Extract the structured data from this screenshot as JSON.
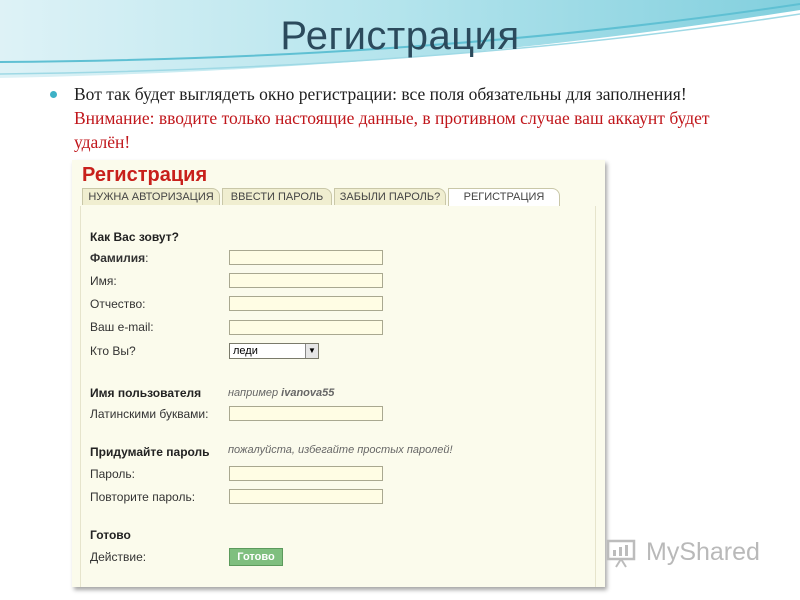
{
  "slide": {
    "title": "Регистрация",
    "bullet_text": "Вот так будет выглядеть окно регистрации: все поля обязательны для заполнения! ",
    "bullet_warning": "Внимание: вводите только настоящие данные, в противном случае ваш аккаунт будет удалён!"
  },
  "window": {
    "header": "Регистрация",
    "tabs": [
      "НУЖНА АВТОРИЗАЦИЯ",
      "ВВЕСТИ ПАРОЛЬ",
      "ЗАБЫЛИ ПАРОЛЬ?",
      "РЕГИСТРАЦИЯ"
    ],
    "active_tab": "РЕГИСТРАЦИЯ",
    "section_name": "Как Вас зовут?",
    "surname_label": "Фамилия",
    "surname_colon": ":",
    "name_label": "Имя:",
    "patronymic_label": "Отчество:",
    "email_label": "Ваш e-mail:",
    "who_label": "Кто Вы?",
    "who_value": "леди",
    "section_username": "Имя пользователя",
    "username_hint_prefix": "например ",
    "username_hint_example": "ivanova55",
    "latin_label": "Латинскими буквами:",
    "section_password": "Придумайте пароль",
    "password_hint": "пожалуйста, избегайте простых паролей!",
    "password_label": "Пароль:",
    "repeat_password_label": "Повторите пароль:",
    "section_done": "Готово",
    "action_label": "Действие:",
    "submit_label": "Готово"
  },
  "watermark": {
    "text": "MyShared"
  },
  "colors": {
    "title": "#2b4a5c",
    "warning": "#c0161b",
    "header_red": "#c8201b",
    "button_green": "#7fbf7f",
    "bullet": "#3db1c6"
  }
}
